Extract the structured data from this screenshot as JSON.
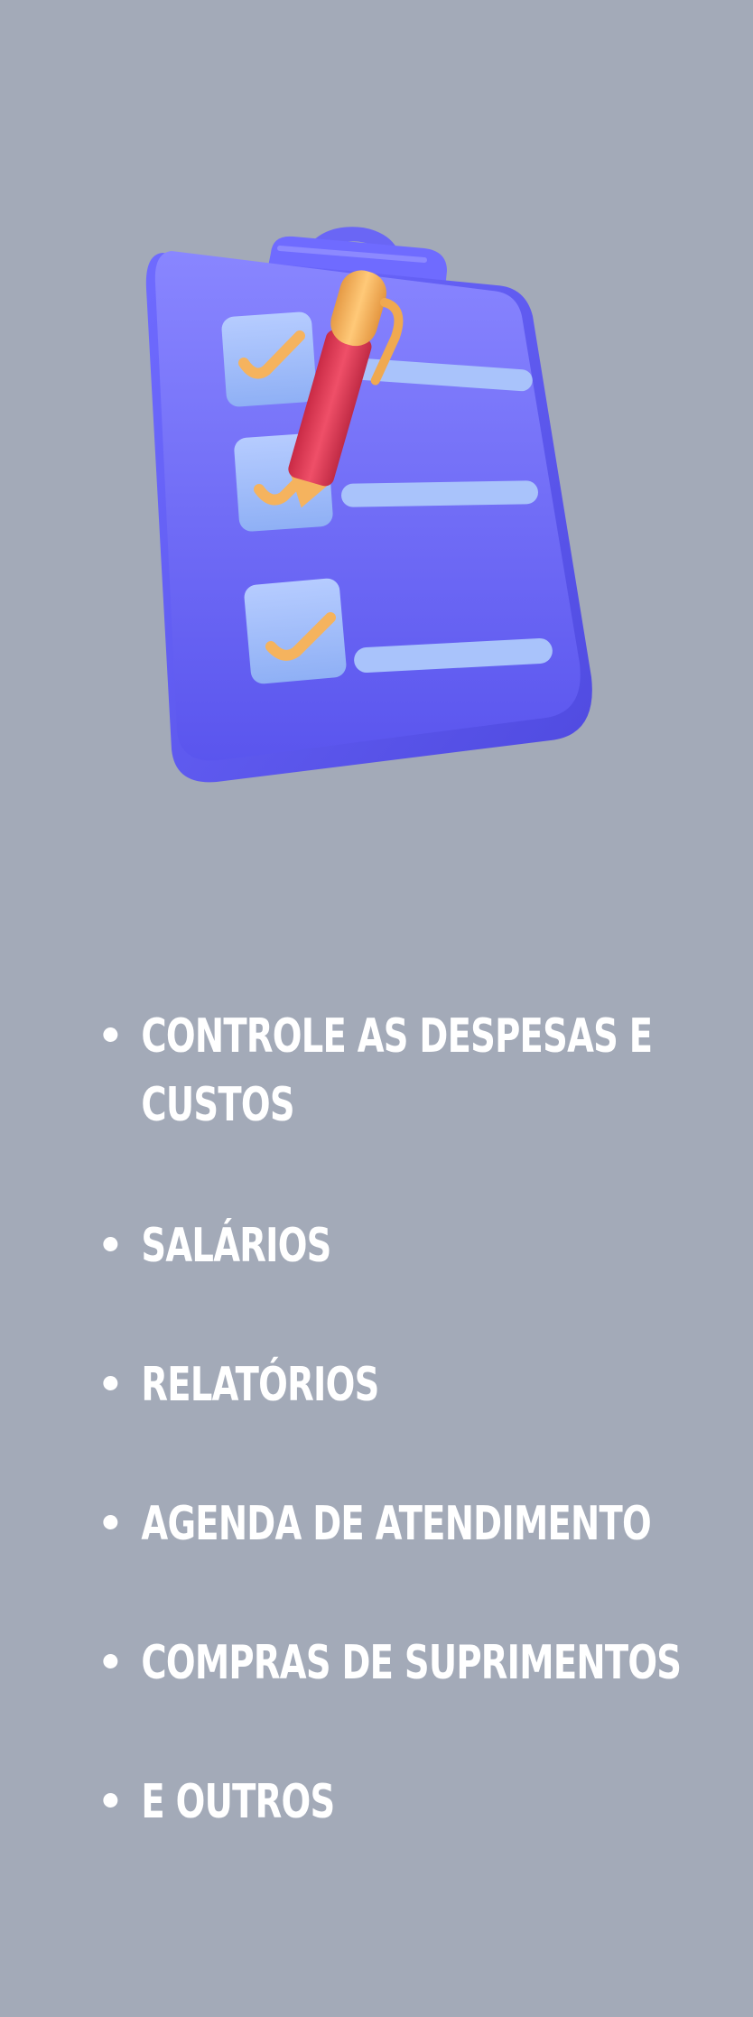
{
  "colors": {
    "background": "#a3aab8",
    "clipboard": "#6b67f2",
    "clipboard_light": "#8a87ff",
    "checkbox": "#a9c3fb",
    "check": "#f5b35e",
    "pen_body": "#e0405a",
    "pen_cap": "#f5b35e",
    "text": "#ffffff"
  },
  "illustration": {
    "icon": "clipboard-checklist-with-pen-icon",
    "checked_items": 3
  },
  "features": [
    {
      "label": "Controle as despesas e custos"
    },
    {
      "label": "Salários"
    },
    {
      "label": "Relatórios"
    },
    {
      "label": "Agenda de atendimento"
    },
    {
      "label": "Compras de suprimentos"
    },
    {
      "label": "E outros"
    }
  ]
}
